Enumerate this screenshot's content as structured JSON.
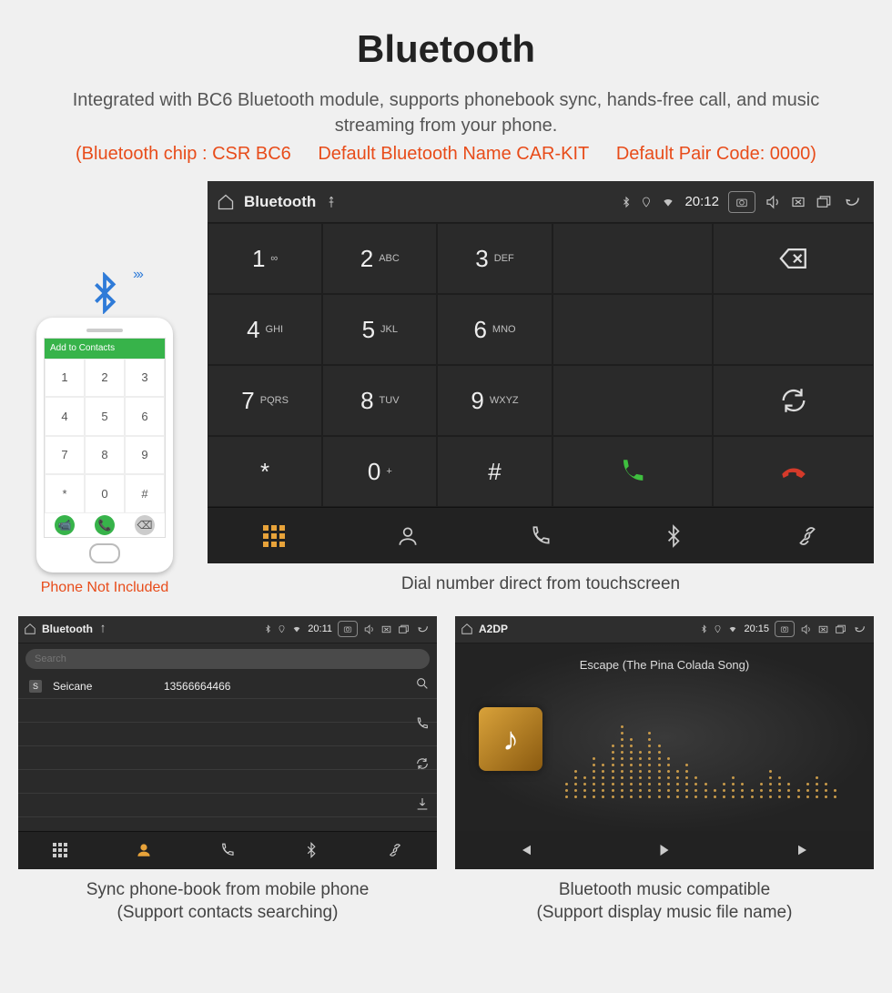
{
  "page": {
    "title": "Bluetooth",
    "subtitle": "Integrated with BC6 Bluetooth module, supports phonebook sync, hands-free call, and music streaming from your phone.",
    "spec_chip": "(Bluetooth chip : CSR BC6",
    "spec_name": "Default Bluetooth Name CAR-KIT",
    "spec_pair": "Default Pair Code: 0000)"
  },
  "phone": {
    "bar_label": "Add to Contacts",
    "not_included": "Phone Not Included",
    "keys": [
      "1",
      "2",
      "3",
      "4",
      "5",
      "6",
      "7",
      "8",
      "9",
      "*",
      "0",
      "#"
    ]
  },
  "dialer": {
    "status": {
      "title": "Bluetooth",
      "time": "20:12"
    },
    "keys": [
      {
        "num": "1",
        "sub": "∞"
      },
      {
        "num": "2",
        "sub": "ABC"
      },
      {
        "num": "3",
        "sub": "DEF"
      },
      {
        "num": "4",
        "sub": "GHI"
      },
      {
        "num": "5",
        "sub": "JKL"
      },
      {
        "num": "6",
        "sub": "MNO"
      },
      {
        "num": "7",
        "sub": "PQRS"
      },
      {
        "num": "8",
        "sub": "TUV"
      },
      {
        "num": "9",
        "sub": "WXYZ"
      },
      {
        "num": "*",
        "sub": ""
      },
      {
        "num": "0",
        "sub": "+"
      },
      {
        "num": "#",
        "sub": ""
      }
    ],
    "caption": "Dial number direct from touchscreen"
  },
  "contacts": {
    "status": {
      "title": "Bluetooth",
      "time": "20:11"
    },
    "search_placeholder": "Search",
    "rows": [
      {
        "badge": "S",
        "name": "Seicane",
        "number": "13566664466"
      }
    ],
    "caption_line1": "Sync phone-book from mobile phone",
    "caption_line2": "(Support contacts searching)"
  },
  "a2dp": {
    "status": {
      "title": "A2DP",
      "time": "20:15"
    },
    "song": "Escape (The Pina Colada Song)",
    "eq_heights": [
      3,
      5,
      4,
      7,
      6,
      9,
      12,
      10,
      8,
      11,
      9,
      7,
      5,
      6,
      4,
      3,
      2,
      3,
      4,
      3,
      2,
      3,
      5,
      4,
      3,
      2,
      3,
      4,
      3,
      2
    ],
    "caption_line1": "Bluetooth music compatible",
    "caption_line2": "(Support display music file name)"
  }
}
